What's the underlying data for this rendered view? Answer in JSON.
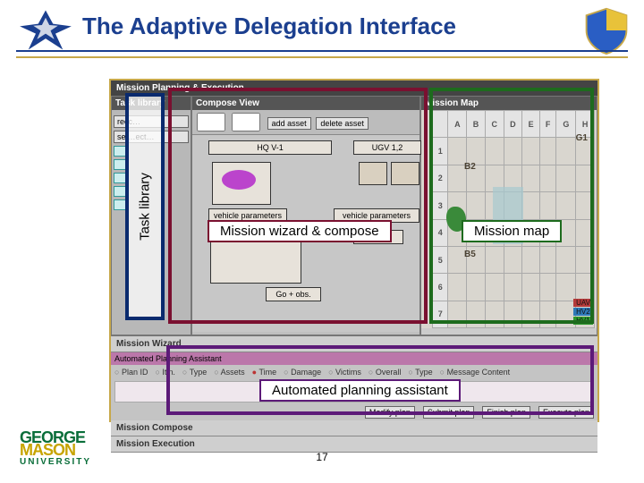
{
  "title": "The Adaptive Delegation Interface",
  "page_number": "17",
  "app": {
    "window_title": "Mission Planning & Execution",
    "library": {
      "header": "Task library",
      "buttons": [
        "recc…",
        "sel…ect…"
      ],
      "items": [
        "",
        "",
        "",
        "",
        "",
        ""
      ]
    },
    "compose": {
      "header": "Compose View",
      "toolbar": {
        "add": "add asset",
        "del": "delete asset"
      },
      "nodes": {
        "hq": "HQ V-1",
        "ugv": "UGV 1,2",
        "vp": "vehicle parameters",
        "ip": "vehicle parameters",
        "tasks": "tasks",
        "go": "Go + obs."
      }
    },
    "map": {
      "header": "Mission Map",
      "cols": [
        "A",
        "B",
        "C",
        "D",
        "E",
        "F",
        "G",
        "H"
      ],
      "rows": [
        "1",
        "2",
        "3",
        "4",
        "5",
        "6",
        "7"
      ],
      "labels": {
        "g1": "G1",
        "b2": "B2",
        "b5": "B5"
      },
      "legend": [
        {
          "name": "UAV",
          "color": "#b43a3a"
        },
        {
          "name": "HV2",
          "color": "#2e7ab8"
        },
        {
          "name": "HV1",
          "color": "#2e9a2e"
        }
      ]
    },
    "rows": {
      "wizard": "Mission Wizard",
      "compose": "Mission Compose",
      "execute": "Mission Execution"
    },
    "apa": {
      "header": "Automated Planning Assistant",
      "cols_left": [
        "Plan ID",
        "Itin.",
        "Type",
        "Assets"
      ],
      "radios": [
        "Time",
        "Damage",
        "Victims",
        "Overall"
      ],
      "cols_right": [
        "Type",
        "Message Content"
      ],
      "foot": [
        "Modify plan",
        "Submit plan",
        "Finish plan",
        "Execute plan"
      ]
    }
  },
  "overlays": {
    "lib": "Task library",
    "comp": "Mission wizard & compose",
    "map": "Mission map",
    "apa": "Automated planning assistant"
  },
  "gmu": {
    "g": "GEORGE",
    "m": "MASON",
    "u": "UNIVERSITY"
  }
}
